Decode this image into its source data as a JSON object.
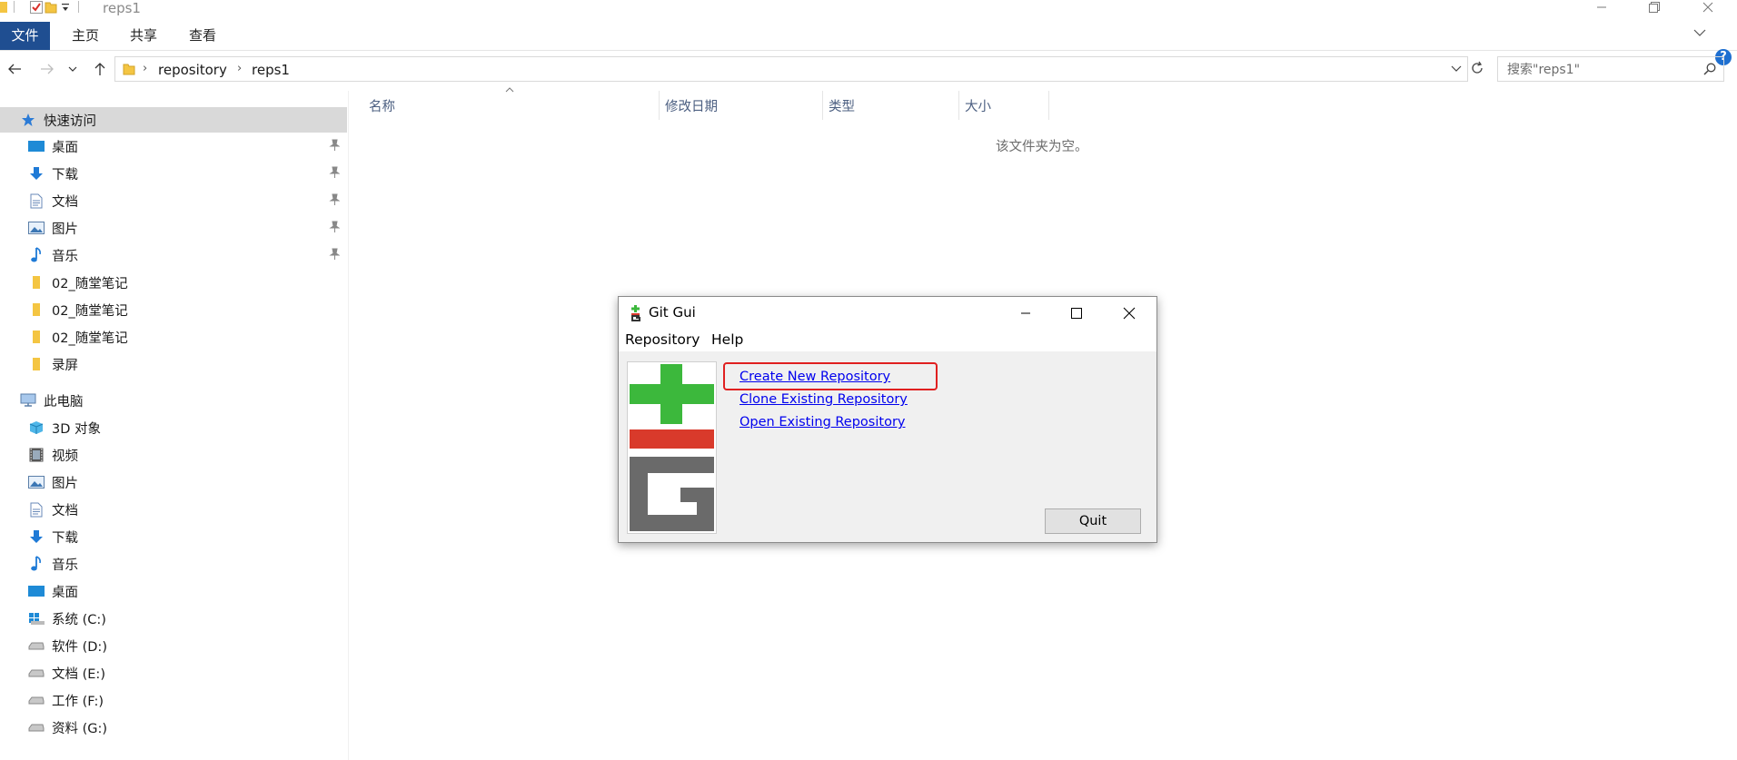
{
  "window": {
    "title": "reps1",
    "controls": [
      "minimize-icon",
      "restore-icon",
      "close-icon"
    ]
  },
  "ribbon": {
    "tabs": [
      {
        "label": "文件",
        "active": true
      },
      {
        "label": "主页"
      },
      {
        "label": "共享"
      },
      {
        "label": "查看"
      }
    ]
  },
  "address": {
    "crumbs": [
      "repository",
      "reps1"
    ]
  },
  "search": {
    "placeholder": "搜索\"reps1\""
  },
  "sidebar": {
    "quick_access": "快速访问",
    "quick_items": [
      {
        "label": "桌面",
        "icon": "desktop-icon",
        "pinned": true
      },
      {
        "label": "下载",
        "icon": "download-icon",
        "pinned": true
      },
      {
        "label": "文档",
        "icon": "document-icon",
        "pinned": true
      },
      {
        "label": "图片",
        "icon": "picture-icon",
        "pinned": true
      },
      {
        "label": "音乐",
        "icon": "music-icon",
        "pinned": true
      },
      {
        "label": "02_随堂笔记",
        "icon": "folder-icon"
      },
      {
        "label": "02_随堂笔记",
        "icon": "folder-icon"
      },
      {
        "label": "02_随堂笔记",
        "icon": "folder-icon"
      },
      {
        "label": "录屏",
        "icon": "folder-icon"
      }
    ],
    "this_pc": "此电脑",
    "pc_items": [
      {
        "label": "3D 对象",
        "icon": "3d-objects-icon"
      },
      {
        "label": "视频",
        "icon": "video-icon"
      },
      {
        "label": "图片",
        "icon": "picture-icon"
      },
      {
        "label": "文档",
        "icon": "document-icon"
      },
      {
        "label": "下载",
        "icon": "download-icon"
      },
      {
        "label": "音乐",
        "icon": "music-icon"
      },
      {
        "label": "桌面",
        "icon": "desktop-icon"
      },
      {
        "label": "系统 (C:)",
        "icon": "windows-drive-icon"
      },
      {
        "label": "软件 (D:)",
        "icon": "drive-icon"
      },
      {
        "label": "文档 (E:)",
        "icon": "drive-icon"
      },
      {
        "label": "工作 (F:)",
        "icon": "drive-icon"
      },
      {
        "label": "资料 (G:)",
        "icon": "drive-icon"
      }
    ]
  },
  "content": {
    "columns": [
      "名称",
      "修改日期",
      "类型",
      "大小"
    ],
    "empty_message": "该文件夹为空。"
  },
  "dialog": {
    "title": "Git Gui",
    "menus": [
      "Repository",
      "Help"
    ],
    "links": [
      "Create New Repository",
      "Clone Existing Repository",
      "Open Existing Repository"
    ],
    "quit_label": "Quit",
    "logo_colors": {
      "plus": "#3cb83c",
      "minus": "#d93a2b",
      "letter": "#6a6a6a"
    },
    "highlight_color": "#e02020"
  }
}
